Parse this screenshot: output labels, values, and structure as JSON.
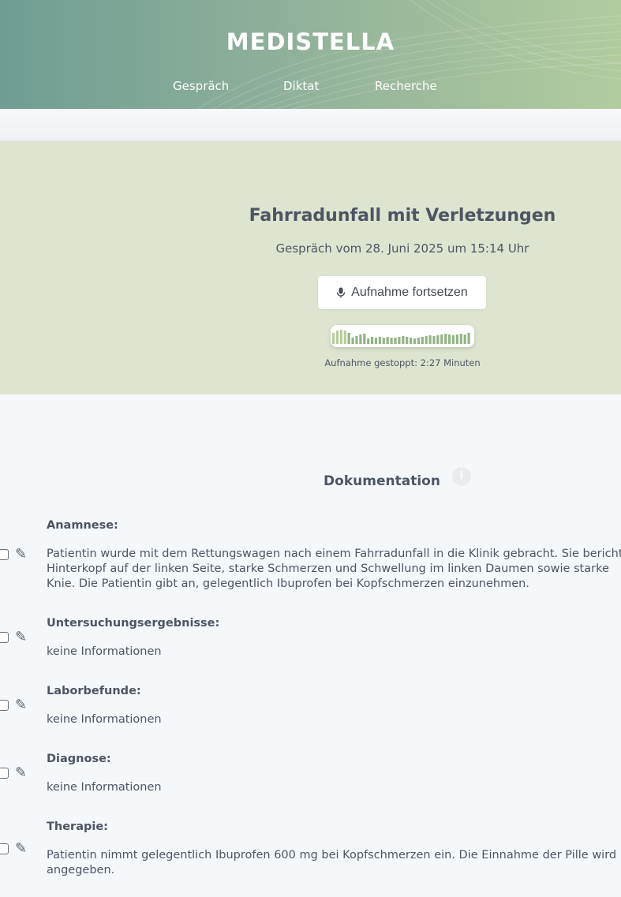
{
  "app": {
    "brand": "MEDISTELLA",
    "nav": [
      {
        "label": "Gespräch"
      },
      {
        "label": "Diktat"
      },
      {
        "label": "Recherche"
      }
    ]
  },
  "session": {
    "title": "Fahrradunfall mit Verletzungen",
    "date": "Gespräch vom 28. Juni 2025 um 15:14 Uhr",
    "resume_button": "Aufnahme fortsetzen",
    "resume_icon": "microphone-icon",
    "recording_status": "Aufnahme gestoppt: 2:27 Minuten"
  },
  "documentation": {
    "title": "Dokumentation",
    "info_icon": "i",
    "sections": [
      {
        "label": "Anamnese:",
        "text": "Patientin wurde mit dem Rettungswagen nach einem Fahrradunfall in die Klinik gebracht. Sie berichtet\nHinterkopf auf der linken Seite, starke Schmerzen und Schwellung im linken Daumen sowie starke\nKnie. Die Patientin gibt an, gelegentlich Ibuprofen bei Kopfschmerzen einzunehmen."
      },
      {
        "label": "Untersuchungsergebnisse:",
        "text": "keine Informationen"
      },
      {
        "label": "Laborbefunde:",
        "text": "keine Informationen"
      },
      {
        "label": "Diagnose:",
        "text": "keine Informationen"
      },
      {
        "label": "Therapie:",
        "text": "Patientin nimmt gelegentlich Ibuprofen 600 mg bei Kopfschmerzen ein. Die Einnahme der Pille wird\nangegeben."
      }
    ]
  },
  "colors": {
    "header_start": "#6f9d93",
    "header_end": "#b2cc9f",
    "session_bg": "#dde5d0",
    "waveform": "#94b486"
  }
}
